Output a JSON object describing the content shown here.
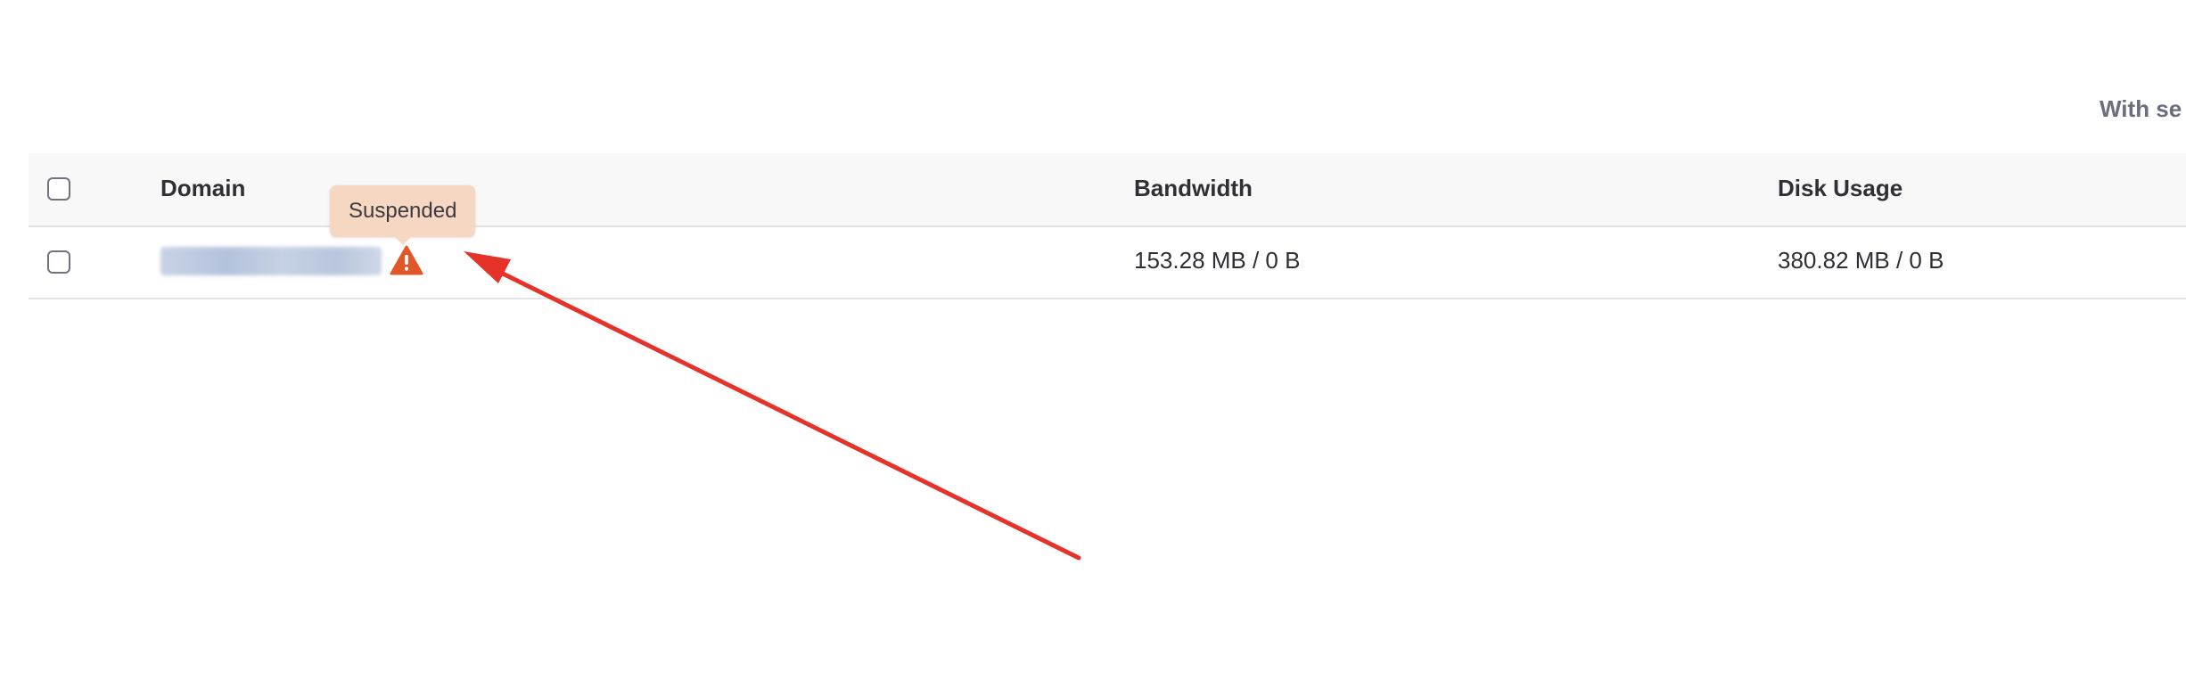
{
  "bulk_actions": {
    "label": "With se"
  },
  "table": {
    "headers": {
      "domain": "Domain",
      "bandwidth": "Bandwidth",
      "disk_usage": "Disk Usage"
    },
    "rows": [
      {
        "domain_redacted": true,
        "status_icon": "warning-icon",
        "status_tooltip": "Suspended",
        "bandwidth": "153.28 MB / 0 B",
        "disk_usage": "380.82 MB / 0 B"
      }
    ]
  },
  "annotation": {
    "type": "arrow",
    "color": "#e5332a"
  },
  "colors": {
    "warning": "#e0582a",
    "tooltip_background": "#f6d7c2",
    "header_background": "#f8f8f8"
  }
}
